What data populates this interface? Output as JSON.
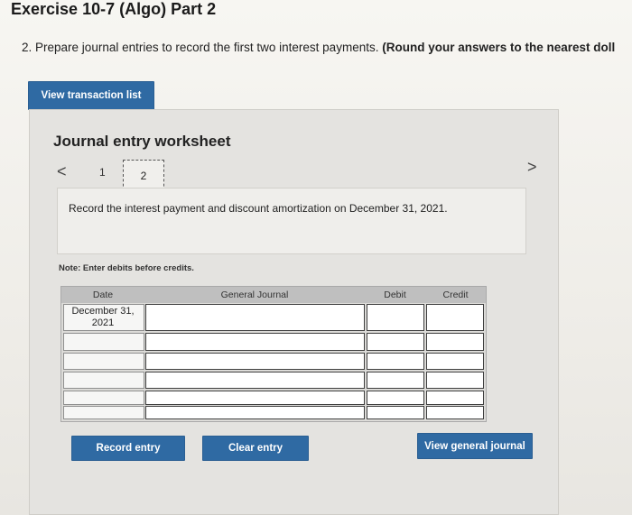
{
  "exercise": {
    "title": "Exercise 10-7 (Algo) Part 2",
    "question_number": "2.",
    "question_text": "Prepare journal entries to record the first two interest payments.",
    "question_bold": "(Round your answers to the nearest doll"
  },
  "buttons": {
    "view_transaction_list": "View transaction list",
    "record_entry": "Record entry",
    "clear_entry": "Clear entry",
    "view_general_journal": "View general journal"
  },
  "worksheet": {
    "title": "Journal entry worksheet",
    "nav_prev": "<",
    "nav_next": ">",
    "pages": [
      "1",
      "2"
    ],
    "current_page": "2",
    "instruction": "Record the interest payment and discount amortization on December 31, 2021.",
    "note": "Note: Enter debits before credits."
  },
  "journal": {
    "headers": {
      "date": "Date",
      "general_journal": "General Journal",
      "debit": "Debit",
      "credit": "Credit"
    },
    "rows": [
      {
        "date": "December 31, 2021",
        "account": "",
        "debit": "",
        "credit": ""
      },
      {
        "date": "",
        "account": "",
        "debit": "",
        "credit": ""
      },
      {
        "date": "",
        "account": "",
        "debit": "",
        "credit": ""
      },
      {
        "date": "",
        "account": "",
        "debit": "",
        "credit": ""
      },
      {
        "date": "",
        "account": "",
        "debit": "",
        "credit": ""
      },
      {
        "date": "",
        "account": "",
        "debit": "",
        "credit": ""
      }
    ]
  },
  "colors": {
    "button_blue": "#2f6aa3",
    "worksheet_bg": "#e4e3e0",
    "header_gray": "#bfbfbf"
  }
}
